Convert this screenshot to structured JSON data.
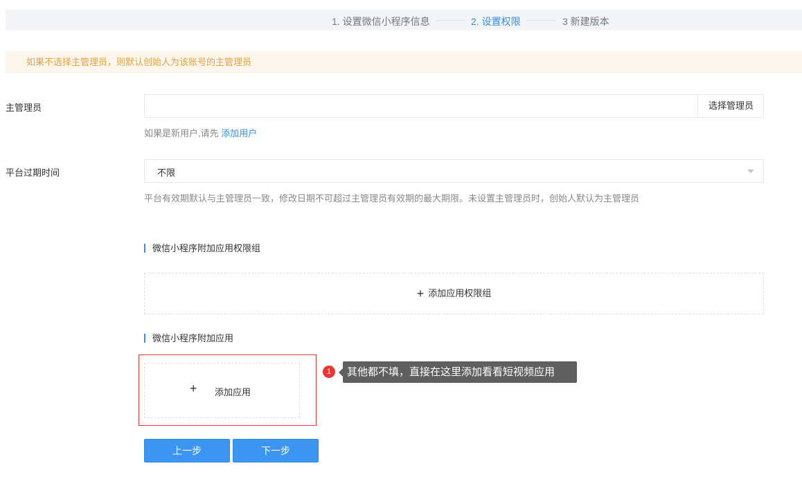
{
  "steps": {
    "step1": "1. 设置微信小程序信息",
    "step2": "2. 设置权限",
    "step3": "3 新建版本"
  },
  "notice": "如果不选择主管理员，则默认创始人为该账号的主管理员",
  "admin": {
    "label": "主管理员",
    "value": "",
    "select_button": "选择管理员",
    "hint_prefix": "如果是新用户,请先",
    "hint_link": "添加用户"
  },
  "expiry": {
    "label": "平台过期时间",
    "value": "不限",
    "hint": "平台有效期默认与主管理员一致，修改日期不可超过主管理员有效期的最大期限。未设置主管理员时，创始人默认为主管理员"
  },
  "permission_group": {
    "title": "微信小程序附加应用权限组",
    "add_label": "添加应用权限组"
  },
  "apps": {
    "title": "微信小程序附加应用",
    "add_label": "添加应用"
  },
  "annotation": {
    "badge": "1",
    "tip": "其他都不填，直接在这里添加看看短视频应用"
  },
  "buttons": {
    "prev": "上一步",
    "next": "下一步"
  },
  "colors": {
    "accent": "#3a8ee6",
    "warning_text": "#e6a23c",
    "warning_bg": "#fdf6ec",
    "highlight": "#e53935",
    "tooltip_bg": "#5f5f5f"
  },
  "icons": {
    "plus": "plus-icon",
    "caret": "chevron-down-icon"
  }
}
